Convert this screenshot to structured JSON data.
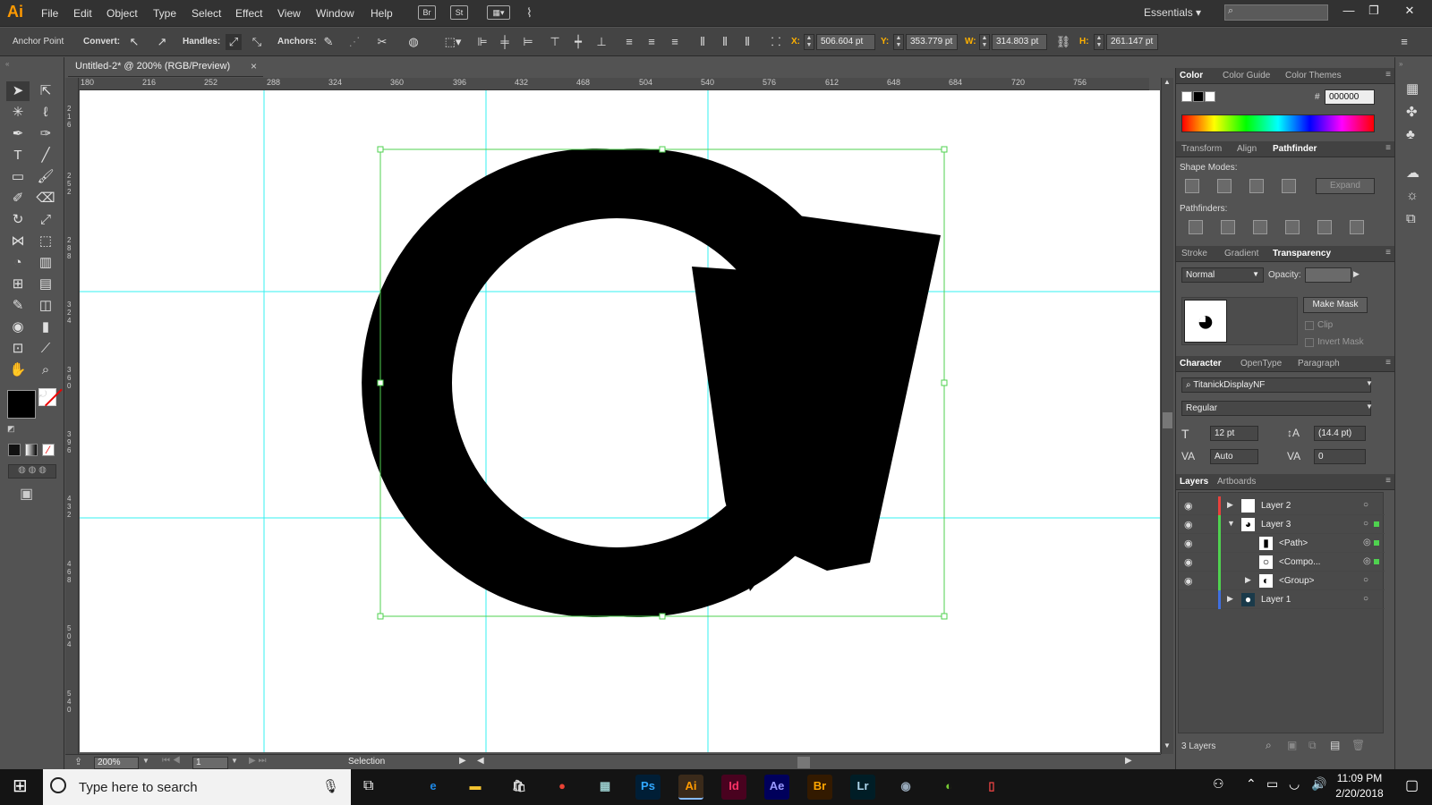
{
  "app": {
    "logo": "Ai"
  },
  "menu": [
    "File",
    "Edit",
    "Object",
    "Type",
    "Select",
    "Effect",
    "View",
    "Window",
    "Help"
  ],
  "bridge_icons": [
    "Br",
    "St"
  ],
  "workspace": "Essentials",
  "control": {
    "mode_label": "Anchor Point",
    "convert_label": "Convert:",
    "handles_label": "Handles:",
    "anchors_label": "Anchors:",
    "x_key": "X:",
    "x_value": "506.604 pt",
    "y_key": "Y:",
    "y_value": "353.779 pt",
    "w_key": "W:",
    "w_value": "314.803 pt",
    "h_key": "H:",
    "h_value": "261.147 pt"
  },
  "document": {
    "tab_title": "Untitled-2* @ 200% (RGB/Preview)",
    "close": "×"
  },
  "ruler_top": [
    "180",
    "216",
    "252",
    "288",
    "324",
    "360",
    "396",
    "432",
    "468",
    "504",
    "540",
    "576",
    "612",
    "648",
    "684",
    "720",
    "756"
  ],
  "ruler_left": [
    "216",
    "252",
    "288",
    "324",
    "360",
    "396",
    "432",
    "468",
    "504",
    "540"
  ],
  "status": {
    "zoom": "200%",
    "artboard": "1",
    "tool": "Selection"
  },
  "color_panel": {
    "tabs": [
      "Color",
      "Color Guide",
      "Color Themes"
    ],
    "hex_symbol": "#",
    "hex": "000000"
  },
  "pathfinder_panel": {
    "tabs": [
      "Transform",
      "Align",
      "Pathfinder"
    ],
    "shape_modes": "Shape Modes:",
    "expand": "Expand",
    "pathfinders": "Pathfinders:"
  },
  "transparency_panel": {
    "tabs": [
      "Stroke",
      "Gradient",
      "Transparency"
    ],
    "blend_mode": "Normal",
    "opacity_label": "Opacity:",
    "make_mask": "Make Mask",
    "clip": "Clip",
    "invert_mask": "Invert Mask"
  },
  "character_panel": {
    "tabs": [
      "Character",
      "OpenType",
      "Paragraph"
    ],
    "font": "TitanickDisplayNF",
    "style": "Regular",
    "size": "12 pt",
    "leading": "(14.4 pt)",
    "kerning": "Auto",
    "tracking": "0"
  },
  "layers_panel": {
    "tabs": [
      "Layers",
      "Artboards"
    ],
    "rows": [
      {
        "name": "Layer 2",
        "color": "#e8413c"
      },
      {
        "name": "Layer 3",
        "color": "#4fd24f"
      },
      {
        "name": "<Path>",
        "color": "#4fd24f"
      },
      {
        "name": "<Compo...",
        "color": "#4fd24f"
      },
      {
        "name": "<Group>",
        "color": "#4fd24f"
      },
      {
        "name": "Layer 1",
        "color": "#3f6fe0"
      }
    ],
    "count": "3 Layers"
  },
  "taskbar": {
    "search_placeholder": "Type here to search",
    "apps": [
      {
        "label": "e",
        "color": "#1e88e5",
        "bg": "transparent"
      },
      {
        "label": "▬",
        "color": "#f4c430",
        "bg": "transparent"
      },
      {
        "label": "🛍",
        "color": "#ddd",
        "bg": "transparent"
      },
      {
        "label": "●",
        "color": "#e94335",
        "bg": "transparent"
      },
      {
        "label": "▦",
        "color": "#9cc",
        "bg": "transparent"
      },
      {
        "label": "Ps",
        "color": "#31a8ff",
        "bg": "#001e36"
      },
      {
        "label": "Ai",
        "color": "#ff9a00",
        "bg": "#330000"
      },
      {
        "label": "Id",
        "color": "#ff3366",
        "bg": "#49021f"
      },
      {
        "label": "Ae",
        "color": "#9999ff",
        "bg": "#00005b"
      },
      {
        "label": "Br",
        "color": "#ffa600",
        "bg": "#331a00"
      },
      {
        "label": "Lr",
        "color": "#add5ec",
        "bg": "#001d26"
      },
      {
        "label": "◉",
        "color": "#9ab",
        "bg": "transparent"
      },
      {
        "label": "◐",
        "color": "#7c3",
        "bg": "transparent"
      },
      {
        "label": "▯",
        "color": "#e44",
        "bg": "transparent"
      }
    ],
    "time": "11:09 PM",
    "date": "2/20/2018"
  }
}
